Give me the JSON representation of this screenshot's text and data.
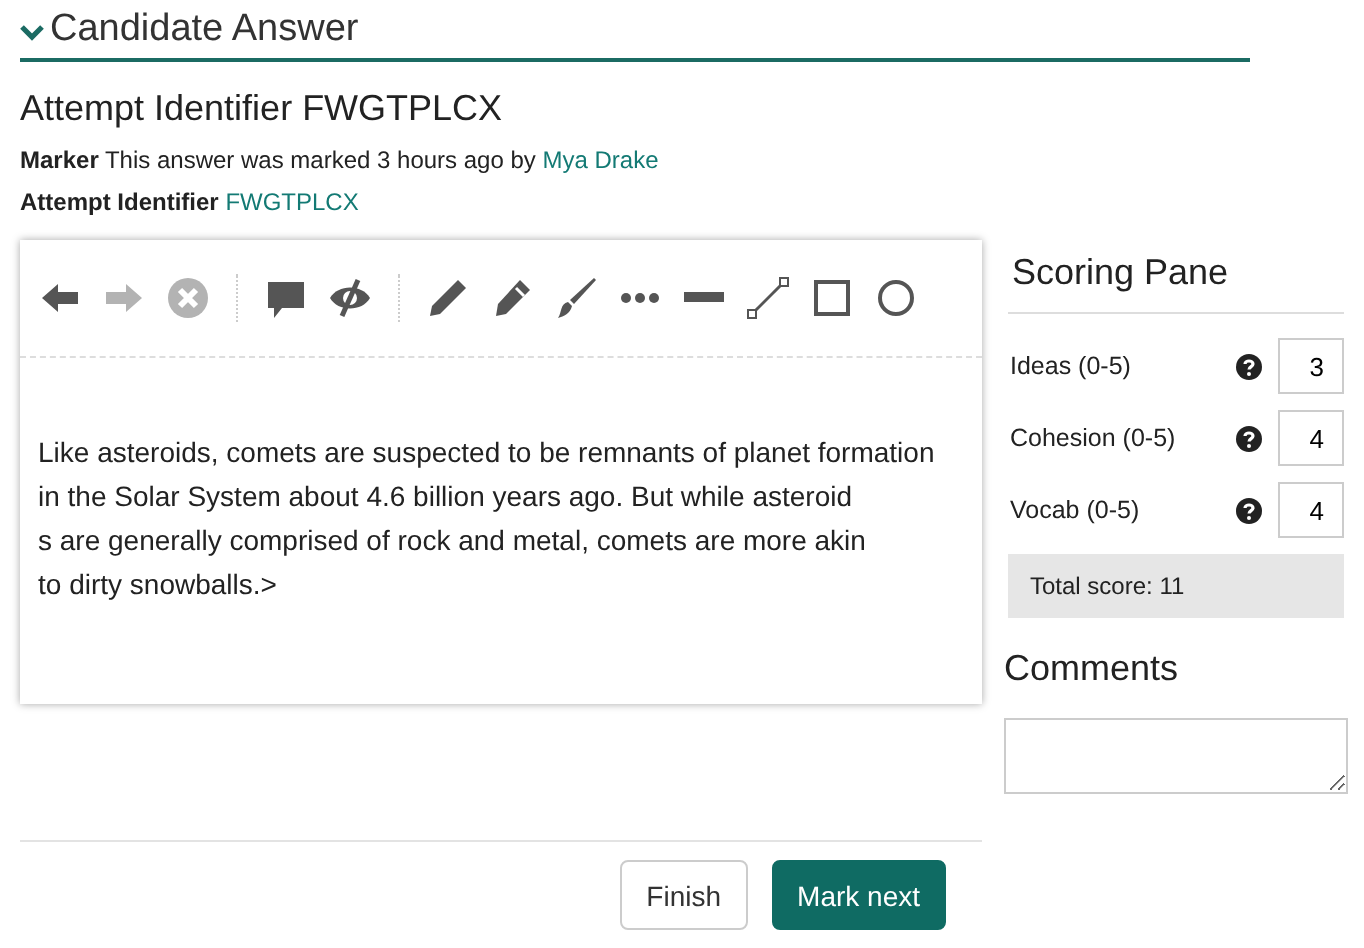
{
  "section": {
    "title": "Candidate Answer",
    "expanded": true
  },
  "attempt": {
    "heading": "Attempt Identifier FWGTPLCX",
    "marker_label": "Marker",
    "marker_text": "This answer was marked 3 hours ago by",
    "marker_name": "Mya Drake",
    "id_label": "Attempt Identifier",
    "id_value": "FWGTPLCX"
  },
  "toolbar": [
    [
      {
        "kind": "back",
        "disabled": false
      },
      {
        "kind": "forward",
        "disabled": true
      },
      {
        "kind": "cancel",
        "disabled": true
      }
    ],
    [
      {
        "kind": "comment",
        "disabled": false
      },
      {
        "kind": "hide",
        "disabled": false
      }
    ],
    [
      {
        "kind": "pencil",
        "disabled": false
      },
      {
        "kind": "pen",
        "disabled": false
      },
      {
        "kind": "brush",
        "disabled": false
      },
      {
        "kind": "dots",
        "disabled": false
      },
      {
        "kind": "bar",
        "disabled": false
      },
      {
        "kind": "line",
        "disabled": false
      },
      {
        "kind": "rect",
        "disabled": false
      },
      {
        "kind": "circle",
        "disabled": false
      }
    ]
  ],
  "answer_lines": [
    "Like asteroids, comets are suspected to be remnants of planet formation",
    "in the Solar System about 4.6 billion years ago. But while asteroid",
    "s are generally comprised of rock and metal, comets are more akin",
    "to dirty snowballs.>"
  ],
  "scoring": {
    "title": "Scoring Pane",
    "criteria": [
      {
        "label": "Ideas (0-5)",
        "value": "3"
      },
      {
        "label": "Cohesion (0-5)",
        "value": "4"
      },
      {
        "label": "Vocab (0-5)",
        "value": "4"
      }
    ],
    "total": "Total score: 11"
  },
  "comments": {
    "title": "Comments"
  },
  "buttons": [
    {
      "label": "Finish",
      "kind": "secondary"
    },
    {
      "label": "Mark next",
      "kind": "primary"
    }
  ]
}
